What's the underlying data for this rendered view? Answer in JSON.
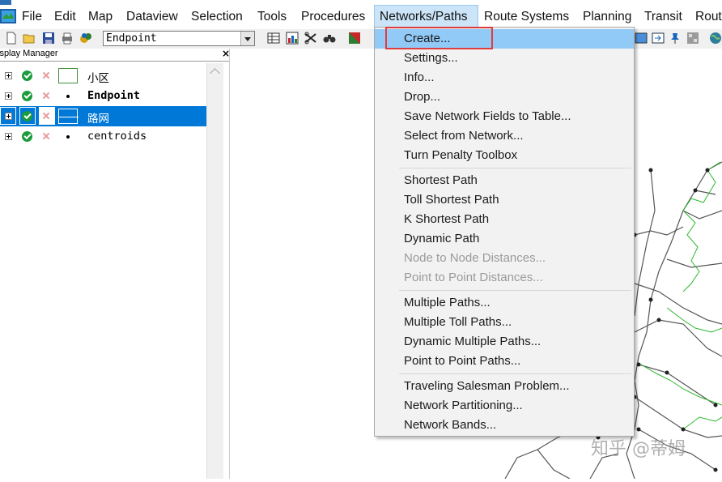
{
  "menubar": {
    "items": [
      {
        "label": "File"
      },
      {
        "label": "Edit"
      },
      {
        "label": "Map"
      },
      {
        "label": "Dataview"
      },
      {
        "label": "Selection"
      },
      {
        "label": "Tools"
      },
      {
        "label": "Procedures"
      },
      {
        "label": "Networks/Paths"
      },
      {
        "label": "Route Systems"
      },
      {
        "label": "Planning"
      },
      {
        "label": "Transit"
      },
      {
        "label": "Rout"
      }
    ],
    "active": "Networks/Paths"
  },
  "toolbar": {
    "layer_select": "Endpoint",
    "icons": [
      "new-icon",
      "open-icon",
      "save-icon",
      "print-icon",
      "palette-icon",
      "table-icon",
      "chart-icon",
      "tool-icon",
      "binoculars-icon",
      "layer-color-icon",
      "pin-icon",
      "globe-icon"
    ]
  },
  "display_manager": {
    "title": "isplay Manager",
    "close": "×",
    "layers": [
      {
        "name": "小区",
        "symbol": "area",
        "bold": false,
        "selected": false
      },
      {
        "name": "Endpoint",
        "symbol": "point",
        "bold": true,
        "selected": false
      },
      {
        "name": "路网",
        "symbol": "line",
        "bold": false,
        "selected": true
      },
      {
        "name": "centroids",
        "symbol": "point",
        "bold": false,
        "selected": false
      }
    ]
  },
  "dropdown": {
    "groups": [
      [
        {
          "label": "Create...",
          "highlighted": true
        },
        {
          "label": "Settings..."
        },
        {
          "label": "Info..."
        },
        {
          "label": "Drop..."
        },
        {
          "label": "Save Network Fields to Table..."
        },
        {
          "label": "Select from Network..."
        },
        {
          "label": "Turn Penalty Toolbox"
        }
      ],
      [
        {
          "label": "Shortest Path"
        },
        {
          "label": "Toll Shortest Path"
        },
        {
          "label": "K Shortest Path"
        },
        {
          "label": "Dynamic Path"
        },
        {
          "label": "Node to Node Distances...",
          "disabled": true
        },
        {
          "label": "Point to Point Distances...",
          "disabled": true
        }
      ],
      [
        {
          "label": "Multiple Paths..."
        },
        {
          "label": "Multiple Toll Paths..."
        },
        {
          "label": "Dynamic Multiple Paths..."
        },
        {
          "label": "Point to Point Paths..."
        }
      ],
      [
        {
          "label": "Traveling Salesman Problem..."
        },
        {
          "label": "Network Partitioning..."
        },
        {
          "label": "Network Bands..."
        }
      ]
    ]
  },
  "colors": {
    "accent": "#0078d7",
    "menu_hover": "#91c9f7",
    "annotation_box": "#e03c3c",
    "zone_border": "#2eb82e",
    "road": "#555555"
  },
  "watermark": "知乎 @蒂姆"
}
